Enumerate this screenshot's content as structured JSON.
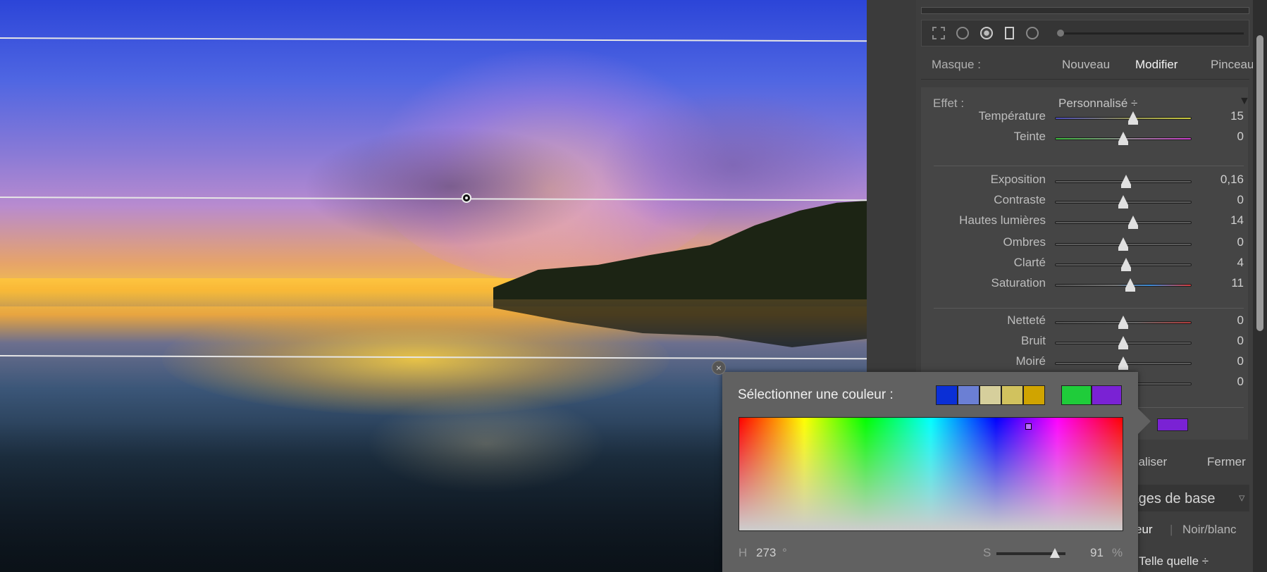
{
  "mask": {
    "label": "Masque :",
    "new": "Nouveau",
    "edit": "Modifier",
    "brush": "Pinceau"
  },
  "effect": {
    "label": "Effet :",
    "preset": "Personnalisé ÷"
  },
  "sliders": [
    {
      "name": "Température",
      "value": "15",
      "pos": 0.57
    },
    {
      "name": "Teinte",
      "value": "0",
      "pos": 0.5
    },
    {
      "name": "Exposition",
      "value": "0,16",
      "pos": 0.52
    },
    {
      "name": "Contraste",
      "value": "0",
      "pos": 0.5
    },
    {
      "name": "Hautes lumières",
      "value": "14",
      "pos": 0.57
    },
    {
      "name": "Ombres",
      "value": "0",
      "pos": 0.5
    },
    {
      "name": "Clarté",
      "value": "4",
      "pos": 0.52
    },
    {
      "name": "Saturation",
      "value": "11",
      "pos": 0.55
    },
    {
      "name": "Netteté",
      "value": "0",
      "pos": 0.5
    },
    {
      "name": "Bruit",
      "value": "0",
      "pos": 0.5
    },
    {
      "name": "Moiré",
      "value": "0",
      "pos": 0.5
    },
    {
      "name": "",
      "value": "0",
      "pos": 0.5
    }
  ],
  "picker": {
    "title": "Sélectionner une couleur :",
    "swatches": [
      "#0a2fd6",
      "#6b7fd4",
      "#d6cf9c",
      "#d1c25e",
      "#d0a400"
    ],
    "recent": [
      "#1fcc3a",
      "#7a22d4"
    ],
    "h_label": "H",
    "h_value": "273",
    "h_unit": "°",
    "s_label": "S",
    "s_value": "91",
    "s_unit": "%",
    "close": "×"
  },
  "color_chip": "#7a22d4",
  "bottom": {
    "reset": "tialiser",
    "close": "Fermer",
    "section": "lages de base",
    "mode_color": "eur",
    "mode_bw": "Noir/blanc",
    "profile": "Telle quelle ÷"
  }
}
